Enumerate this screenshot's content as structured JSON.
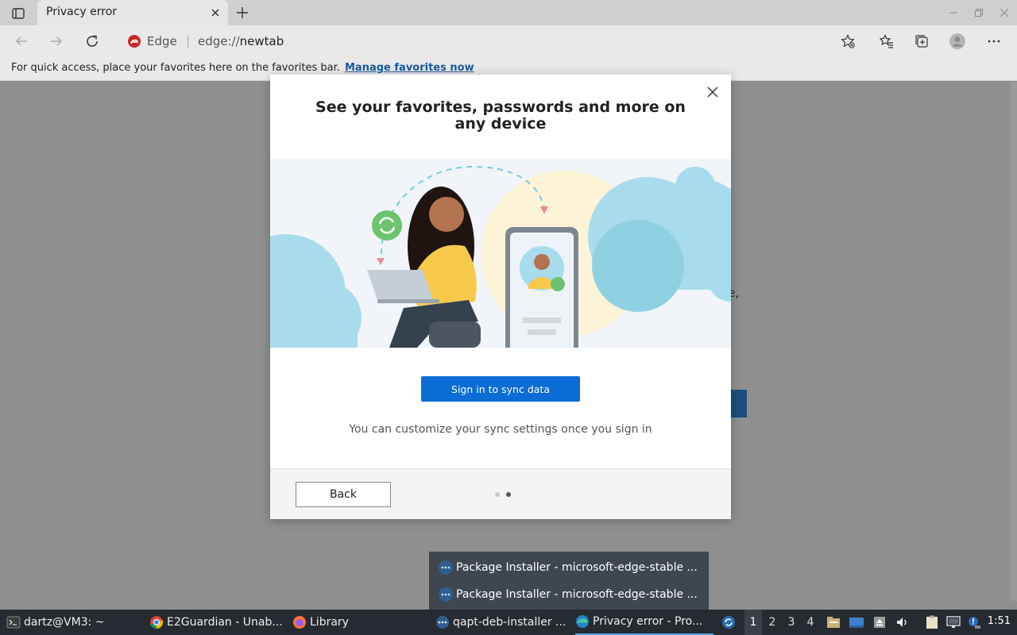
{
  "tab": {
    "title": "Privacy error"
  },
  "address": {
    "site_label": "Edge",
    "separator": "|",
    "scheme": "edge://",
    "path": "newtab"
  },
  "favorites_bar": {
    "message": "For quick access, place your favorites here on the favorites bar.",
    "link": "Manage favorites now"
  },
  "background": {
    "partial_text": "le,"
  },
  "modal": {
    "title": "See your favorites, passwords and more on any device",
    "sync_button": "Sign in to sync data",
    "hint": "You can customize your sync settings once you sign in",
    "back_button": "Back",
    "pager": {
      "total": 2,
      "current": 2
    }
  },
  "popup": {
    "items": [
      "Package Installer - microsoft-edge-stable ...",
      "Package Installer - microsoft-edge-stable ..."
    ]
  },
  "taskbar": {
    "items": [
      {
        "label": "dartz@VM3: ~",
        "icon": "terminal-icon"
      },
      {
        "label": "E2Guardian - Unab...",
        "icon": "chrome-icon"
      },
      {
        "label": "Library",
        "icon": "firefox-icon"
      },
      {
        "label": "qapt-deb-installer ...",
        "icon": "installer-icon"
      },
      {
        "label": "Privacy error - Pro...",
        "icon": "edge-icon"
      }
    ],
    "workspaces": [
      "1",
      "2",
      "3",
      "4"
    ],
    "active_workspace": "1",
    "clock": "1:51"
  },
  "colors": {
    "accent": "#0a6cd4",
    "taskbar": "#262b31",
    "popup": "#3e4650"
  }
}
